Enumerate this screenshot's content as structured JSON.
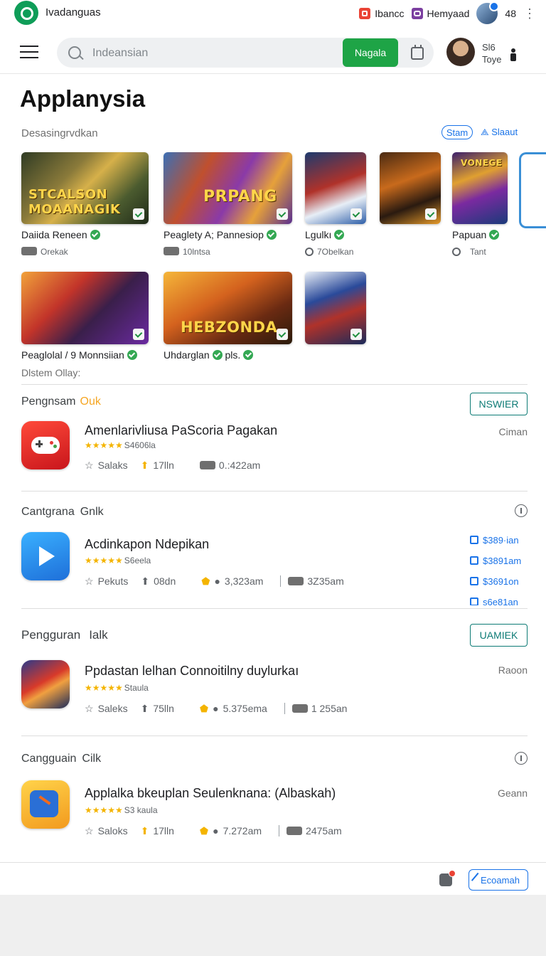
{
  "topbar": {
    "brand": "Ivadanguas",
    "chip1": "Ibancc",
    "chip2": "Hemyaad",
    "count": "48"
  },
  "search": {
    "placeholder": "Indeansian",
    "button": "Nagala"
  },
  "user": {
    "line1": "Sl6",
    "line2": "Toye"
  },
  "page": {
    "title": "Applanysia"
  },
  "featured": {
    "label": "Desasingrvdkan",
    "pill": "Stam",
    "see_all": "Slaaut",
    "cards": [
      {
        "title": "Daiida Reneen",
        "meta": "Orekak",
        "art": "STCALSON MOAANAGIK",
        "verified": true
      },
      {
        "title": "Peaglety A; Pannesiop",
        "meta": "10lntsa",
        "art": "PRPANG",
        "verified": true
      },
      {
        "title": "Lgulkı",
        "meta": "7Obelkan",
        "art": "",
        "verified": true
      },
      {
        "title": "",
        "meta": "",
        "art": "",
        "verified": false
      },
      {
        "title": "Papuan",
        "meta": "Tant",
        "art": "VONEGE",
        "verified": true
      },
      {
        "title": "Peaglolal / 9 Monnsiian",
        "meta": "",
        "art": "",
        "verified": true
      },
      {
        "title": "Uhdarglan",
        "meta": "",
        "art": "HEBZONDA",
        "verified": true
      },
      {
        "title": "",
        "meta": "",
        "art": "",
        "verified": false
      }
    ],
    "extra_title_suffix": "pls.",
    "more_note": "Dlstem Ollay:"
  },
  "sections": [
    {
      "title": "Pengnsam",
      "accent": "Ouk",
      "button": "NSWIER",
      "app": {
        "name": "Amenlarivliusa PaScoria Pagakan",
        "stars": "★★★★★",
        "caption": "S4606la",
        "m1": "Salaks",
        "m2": "17lln",
        "m3": "0.:422am",
        "right": "Ciman"
      }
    },
    {
      "title": "Cantgrana",
      "accent": "Gnlk",
      "app": {
        "name": "Acdinkapon Ndepikan",
        "stars": "★★★★★",
        "caption": "S6eela",
        "m1": "Pekuts",
        "m2": "08dn",
        "m3": "3,323am",
        "m4": "3Z35am"
      },
      "links": [
        "$389·ian",
        "$3891am",
        "$3691on",
        "s6e81an"
      ]
    },
    {
      "title": "Pengguran",
      "accent": "Ialk",
      "button": "UAMIEK",
      "app": {
        "name": "Ppdastan lelhan Connoitilny duylurkaı",
        "stars": "★★★★★",
        "caption": "Staula",
        "m1": "Saleks",
        "m2": "75lln",
        "m3": "5.375ema",
        "m4": "1 255an",
        "right": "Raoon"
      }
    },
    {
      "title": "Cangguain",
      "accent": "Cilk",
      "app": {
        "name": "Applalka bkeuplan Seulenknana: (Albaskah)",
        "stars": "★★★★★",
        "caption": "S3 kaula",
        "m1": "Saloks",
        "m2": "17lln",
        "m3": "7.272am",
        "m4": "2475am",
        "right": "Geann"
      }
    }
  ],
  "bottom": {
    "button": "Ecoamah"
  },
  "colors": {
    "accent_green": "#1ea446",
    "link_blue": "#1a73e8",
    "teal": "#0d7b75",
    "star": "#f4b400"
  }
}
